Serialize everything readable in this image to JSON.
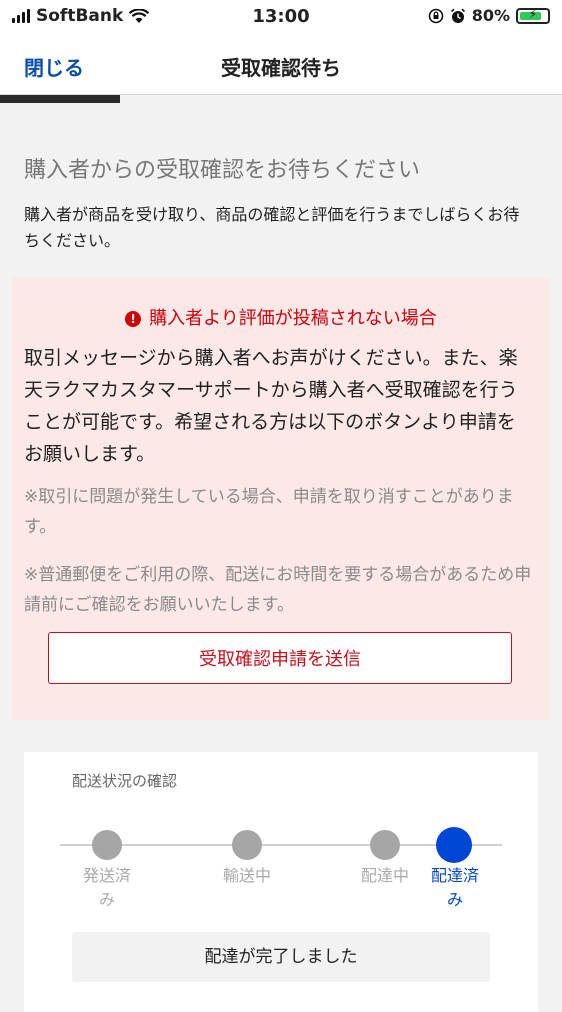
{
  "status_bar": {
    "carrier": "SoftBank",
    "time": "13:00",
    "battery": "80%",
    "battery_level": 0.8,
    "battery_color": "#34c759"
  },
  "nav": {
    "close_label": "閉じる",
    "title": "受取確認待ち"
  },
  "main": {
    "heading": "購入者からの受取確認をお待ちください",
    "description": "購入者が商品を受け取り、商品の確認と評価を行うまでしばらくお待ちください。"
  },
  "warning": {
    "title": "購入者より評価が投稿されない場合",
    "body": "取引メッセージから購入者へお声がけください。また、楽天ラクマカスタマーサポートから購入者へ受取確認を行うことが可能です。希望される方は以下のボタンより申請をお願いします。",
    "note1": "※取引に問題が発生している場合、申請を取り消すことがあります。",
    "note2": "※普通郵便をご利用の際、配送にお時間を要する場合があるため申請前にご確認をお願いいたします。",
    "button_label": "受取確認申請を送信",
    "accent_color": "#d0000b"
  },
  "shipping": {
    "title": "配送状況の確認",
    "steps": [
      {
        "label_line1": "発送済",
        "label_line2": "み"
      },
      {
        "label_line1": "輸送中",
        "label_line2": ""
      },
      {
        "label_line1": "配達中",
        "label_line2": ""
      },
      {
        "label_line1": "配達済",
        "label_line2": "み"
      }
    ],
    "active_step": 3,
    "status": "配達が完了しました",
    "active_color": "#0046d5"
  }
}
